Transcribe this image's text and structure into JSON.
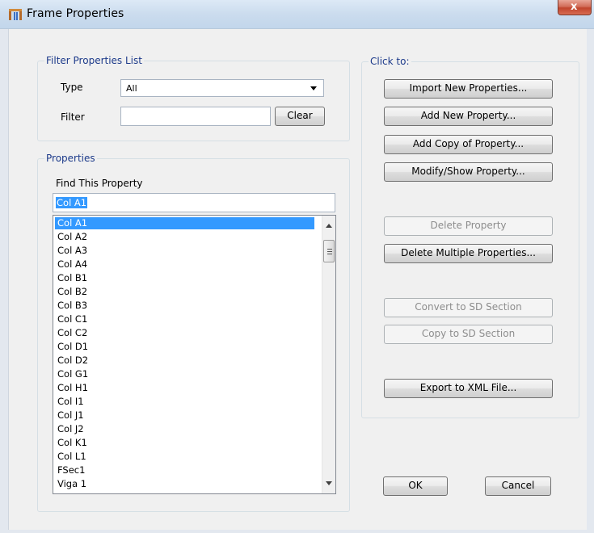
{
  "window": {
    "title": "Frame Properties",
    "close_label": "x"
  },
  "filter_group": {
    "label": "Filter Properties List",
    "type_label": "Type",
    "type_value": "All",
    "filter_label": "Filter",
    "filter_value": "",
    "clear_label": "Clear"
  },
  "properties_group": {
    "label": "Properties",
    "find_label": "Find This Property",
    "find_value": "Col A1",
    "items": [
      "Col A1",
      "Col A2",
      "Col A3",
      "Col A4",
      "Col B1",
      "Col B2",
      "Col B3",
      "Col C1",
      "Col C2",
      "Col D1",
      "Col D2",
      "Col G1",
      "Col H1",
      "Col I1",
      "Col J1",
      "Col J2",
      "Col K1",
      "Col L1",
      "FSec1",
      "Viga 1"
    ],
    "selected_index": 0
  },
  "actions_group": {
    "label": "Click to:",
    "import_label": "Import New Properties...",
    "add_new_label": "Add New Property...",
    "add_copy_label": "Add Copy of Property...",
    "modify_label": "Modify/Show Property...",
    "delete_label": "Delete Property",
    "delete_multiple_label": "Delete Multiple Properties...",
    "convert_sd_label": "Convert to SD Section",
    "copy_sd_label": "Copy to SD Section",
    "export_xml_label": "Export to XML File..."
  },
  "footer": {
    "ok_label": "OK",
    "cancel_label": "Cancel"
  }
}
